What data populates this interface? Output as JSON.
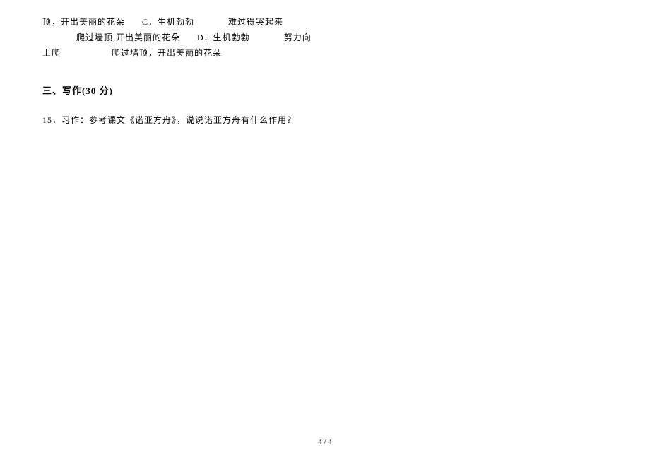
{
  "continuation": {
    "line1_part1": "顶，开出美丽的花朵",
    "line1_optC": "C．生机勃勃",
    "line1_part2": "难过得哭起来",
    "line2_part1": "爬过墙顶,开出美丽的花朵",
    "line2_optD": "D．生机勃勃",
    "line2_part2": "努力向",
    "line3_part1": "上爬",
    "line3_part2": "爬过墙顶，开出美丽的花朵"
  },
  "section": {
    "header": "三、写作(30 分)"
  },
  "question15": {
    "number": "15．",
    "text": "习作：参考课文《诺亚方舟》，说说诺亚方舟有什么作用？"
  },
  "footer": {
    "pageNumber": "4 / 4"
  }
}
